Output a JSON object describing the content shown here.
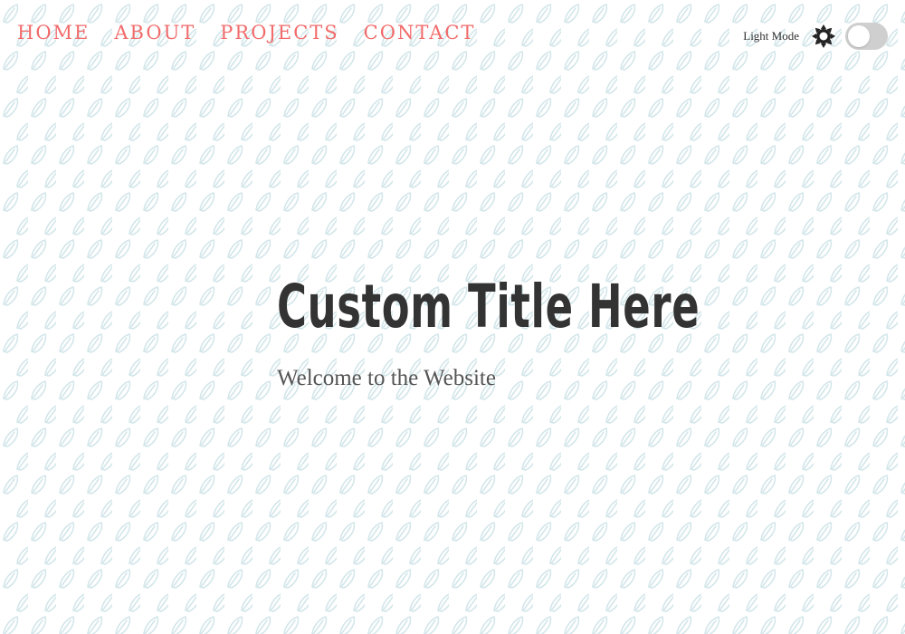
{
  "nav": {
    "items": [
      {
        "label": "HOME"
      },
      {
        "label": "ABOUT"
      },
      {
        "label": "PROJECTS"
      },
      {
        "label": "CONTACT"
      }
    ]
  },
  "theme": {
    "mode_label": "Light Mode",
    "toggle_state": "off",
    "icon": "sun-icon"
  },
  "hero": {
    "title": "Custom Title Here",
    "subtitle": "Welcome to the Website"
  },
  "colors": {
    "nav_link": "#f26b6b",
    "title": "#333333",
    "subtitle": "#555555",
    "background": "#ffffff",
    "pattern_leaf": "#d3e6ea",
    "toggle_track": "#cfcfcf"
  }
}
